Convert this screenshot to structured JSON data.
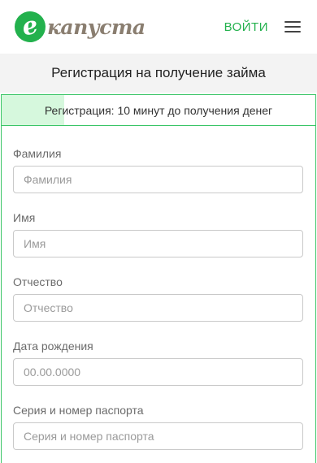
{
  "header": {
    "logo_letter": "e",
    "logo_text": "капуста",
    "login_label": "ВОЙТИ",
    "menu_icon": "hamburger-menu-icon"
  },
  "page_title": "Регистрация на получение займа",
  "progress": {
    "text": "Регистрация: 10 минут до получения денег",
    "fill_fraction": 0.2
  },
  "form": {
    "surname": {
      "label": "Фамилия",
      "placeholder": "Фамилия"
    },
    "name": {
      "label": "Имя",
      "placeholder": "Имя"
    },
    "patronymic": {
      "label": "Отчество",
      "placeholder": "Отчество"
    },
    "birthdate": {
      "label": "Дата рождения",
      "placeholder": "00.00.0000"
    },
    "passport": {
      "label": "Серия и номер паспорта",
      "placeholder": "Серия и номер паспорта"
    }
  },
  "colors": {
    "brand_green": "#23b14d",
    "progress_fill": "#d6f8dd",
    "border_green": "#3ac567"
  }
}
